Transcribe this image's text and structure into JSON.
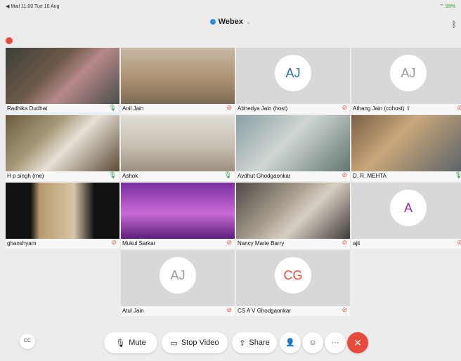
{
  "status": {
    "left": "◀ Mail  11:00  Tue 10 Aug",
    "right": "99%"
  },
  "app": {
    "title": "Webex",
    "chevron": "⌄"
  },
  "participants": [
    {
      "name": "Radhika Dudhat",
      "mic": "on",
      "video": true,
      "active": true
    },
    {
      "name": "Anil Jain",
      "mic": "off",
      "video": true
    },
    {
      "name": "Abhedya Jain (host)",
      "mic": "off",
      "video": false,
      "initials": "AJ",
      "initials_color": "#2d6fb3"
    },
    {
      "name": "Athang Jain (cohost) ⇧",
      "mic": "off",
      "video": false,
      "initials": "AJ",
      "initials_color": "#999999"
    },
    {
      "name": "H p singh (me)",
      "mic": "on",
      "video": true
    },
    {
      "name": "Ashok",
      "mic": "on",
      "video": true
    },
    {
      "name": "Avdhut Ghodgaonkar",
      "mic": "off",
      "video": true
    },
    {
      "name": "D. R. MEHTA",
      "mic": "on",
      "video": true
    },
    {
      "name": "ghanshyam",
      "mic": "off",
      "video": true
    },
    {
      "name": "Mukul Sarkar",
      "mic": "off",
      "video": true
    },
    {
      "name": "Nancy Marie Barry",
      "mic": "off",
      "video": true
    },
    {
      "name": "ajit",
      "mic": "off",
      "video": false,
      "initials": "A",
      "initials_color": "#8e2fa0"
    },
    {
      "name": "Atul Jain",
      "mic": "off",
      "video": false,
      "initials": "AJ",
      "initials_color": "#999999"
    },
    {
      "name": "CS A V Ghodgaonkar",
      "mic": "off",
      "video": false,
      "initials": "CG",
      "initials_color": "#e84b3c"
    }
  ],
  "controls": {
    "cc": "CC",
    "mute": "Mute",
    "stop_video": "Stop Video",
    "share": "Share",
    "participants_icon": "participants-icon",
    "reactions_icon": "reactions-icon",
    "more": "···",
    "leave": "✕"
  },
  "colors": {
    "mic_on": "#2e9a3b",
    "mic_off": "#e84b3c",
    "leave": "#e84b3c",
    "active_outline": "#5ab0e6"
  }
}
